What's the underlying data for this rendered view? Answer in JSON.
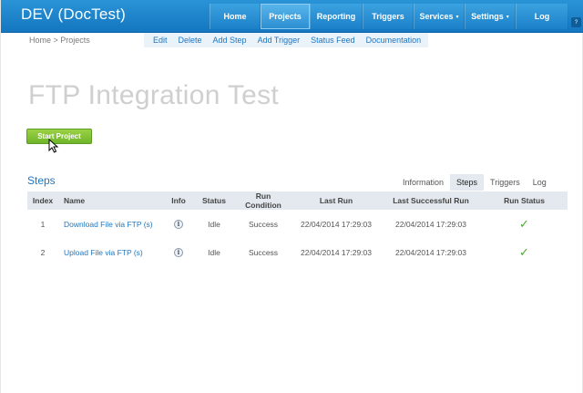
{
  "app_title": "DEV (DocTest)",
  "nav": [
    {
      "label": "Home",
      "name": "nav-home",
      "width": 56,
      "active": false,
      "caret": ""
    },
    {
      "label": "Projects",
      "name": "nav-projects",
      "width": 54,
      "active": true,
      "caret": ""
    },
    {
      "label": "Reporting",
      "name": "nav-reporting",
      "width": 58,
      "active": false,
      "caret": ""
    },
    {
      "label": "Triggers",
      "name": "nav-triggers",
      "width": 56,
      "active": false,
      "caret": ""
    },
    {
      "label": "Services",
      "name": "nav-services",
      "width": 56,
      "active": false,
      "caret": "▾"
    },
    {
      "label": "Settings",
      "name": "nav-settings",
      "width": 56,
      "active": false,
      "caret": "▾"
    },
    {
      "label": "Log",
      "name": "nav-log",
      "width": 58,
      "active": false,
      "caret": ""
    }
  ],
  "help_label": "?",
  "breadcrumb": "Home > Projects",
  "actions": [
    "Edit",
    "Delete",
    "Add Step",
    "Add Trigger",
    "Status Feed",
    "Documentation"
  ],
  "page_title": "FTP Integration Test",
  "start_button": "Start Project",
  "steps_title": "Steps",
  "tabs": [
    {
      "label": "Information",
      "active": false
    },
    {
      "label": "Steps",
      "active": true
    },
    {
      "label": "Triggers",
      "active": false
    },
    {
      "label": "Log",
      "active": false
    }
  ],
  "table": {
    "headers": [
      "Index",
      "Name",
      "Info",
      "Status",
      "Run Condition",
      "Last Run",
      "Last Successful Run",
      "Run Status"
    ],
    "rows": [
      {
        "index": "1",
        "name": "Download File via FTP (s)",
        "info": "i",
        "status": "Idle",
        "run_condition": "Success",
        "last_run": "22/04/2014 17:29:03",
        "last_successful_run": "22/04/2014 17:29:03",
        "run_status": "✓"
      },
      {
        "index": "2",
        "name": "Upload File via FTP (s)",
        "info": "i",
        "status": "Idle",
        "run_condition": "Success",
        "last_run": "22/04/2014 17:29:03",
        "last_successful_run": "22/04/2014 17:29:03",
        "run_status": "✓"
      }
    ]
  }
}
